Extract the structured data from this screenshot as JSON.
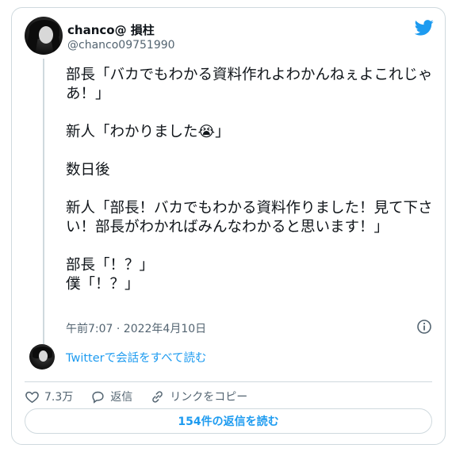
{
  "author": {
    "display_name": "chanco@ 損柱",
    "handle": "@chanco09751990"
  },
  "tweet": {
    "text": "部長「バカでもわかる資料作れよわかんねぇよこれじゃあ！」\n\n新人「わかりました",
    "emoji": "😭",
    "text_after_emoji": "」\n\n数日後\n\n新人「部長！バカでもわかる資料作りました！見て下さい！部長がわかればみんなわかると思います！」\n\n部長「！？」\n僕「！？」",
    "timestamp": "午前7:07 · 2022年4月10日"
  },
  "thread_link": "Twitterで会話をすべて読む",
  "actions": {
    "like_count": "7.3万",
    "reply_label": "返信",
    "copy_link_label": "リンクをコピー"
  },
  "read_replies_button": "154件の返信を読む",
  "colors": {
    "accent": "#1d9bf0",
    "muted": "#536471",
    "border": "#cfd9de"
  }
}
